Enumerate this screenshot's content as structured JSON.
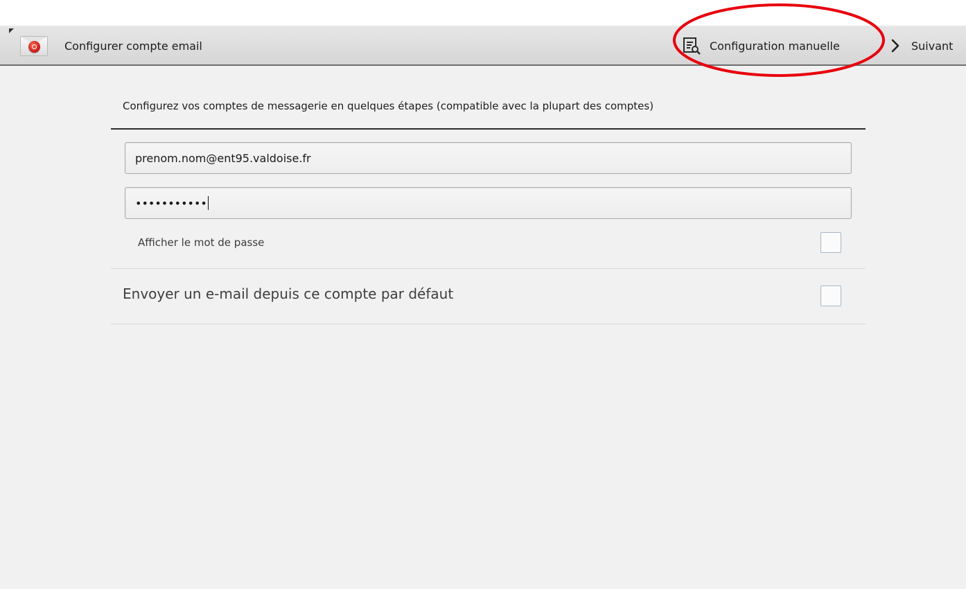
{
  "header": {
    "title": "Configurer compte email",
    "app_icon": "email-app-icon",
    "manual_config_label": "Configuration manuelle",
    "manual_config_icon": "manual-settings-icon",
    "next_label": "Suivant",
    "next_icon": "chevron-right-icon"
  },
  "form": {
    "intro": "Configurez vos comptes de messagerie en quelques étapes (compatible avec la plupart des comptes)",
    "email_value": "prenom.nom@ent95.valdoise.fr",
    "password_masked": "•••••••••••",
    "show_password_label": "Afficher le mot de passe",
    "show_password_checked": false,
    "default_account_label": "Envoyer un e-mail depuis ce compte par défaut",
    "default_account_checked": false
  },
  "colors": {
    "highlight": "#e8000d",
    "background": "#f1f1f1"
  }
}
